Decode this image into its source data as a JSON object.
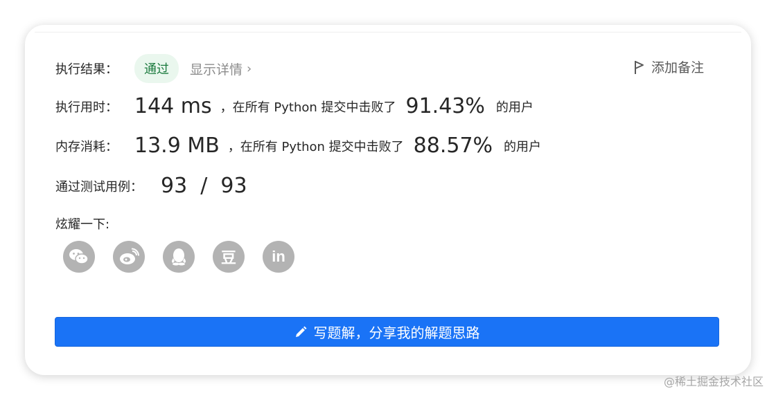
{
  "result": {
    "label": "执行结果：",
    "status": "通过",
    "details_link": "显示详情",
    "details_chevron": "›",
    "note_button": "添加备注"
  },
  "runtime": {
    "label": "执行用时：",
    "value": "144 ms",
    "sentence": "，在所有 Python 提交中击败了",
    "percent": "91.43%",
    "suffix": "的用户"
  },
  "memory": {
    "label": "内存消耗：",
    "value": "13.9 MB",
    "sentence": "，在所有 Python 提交中击败了",
    "percent": "88.57%",
    "suffix": "的用户"
  },
  "tests": {
    "label": "通过测试用例：",
    "value": "93  /  93"
  },
  "share": {
    "label": "炫耀一下:",
    "icons": [
      "wechat-icon",
      "weibo-icon",
      "qq-icon",
      "douban-icon",
      "linkedin-icon"
    ],
    "douban_text": "豆",
    "linkedin_text": "in"
  },
  "write_button": "写题解，分享我的解题思路",
  "watermark": "@稀土掘金技术社区",
  "colors": {
    "badge_bg": "#eaf7ee",
    "badge_text": "#1b7a3e",
    "primary": "#1a73f6",
    "icon_bg": "#b3b3b3"
  }
}
